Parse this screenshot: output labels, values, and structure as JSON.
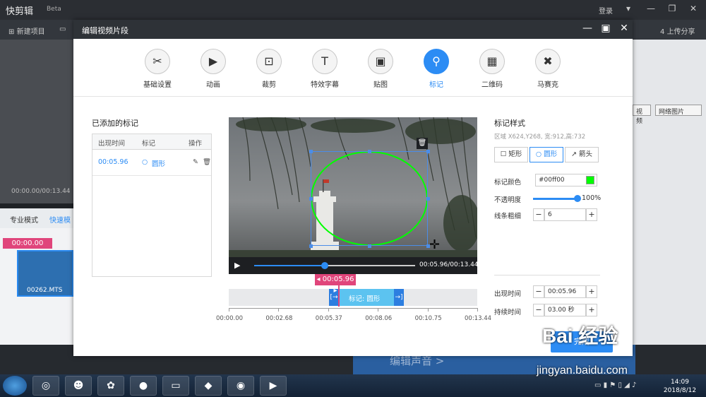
{
  "app": {
    "name": "快剪辑",
    "version": "Beta",
    "login": "登录",
    "new_project": "新建项目",
    "upload_share": "上传分享",
    "upload_step": "4",
    "bg_time": "00:00.00/00:13.44",
    "pro_mode": "专业模式",
    "quick_mode": "快速模",
    "playhead": "00:00.00",
    "clip_name": "00262.MTS",
    "web_image": "网络图片",
    "video_btn": "视频",
    "edit_audio": "编辑声音 >"
  },
  "dialog": {
    "title": "编辑视频片段",
    "tabs": [
      {
        "label": "基础设置",
        "icon": "scissors-icon",
        "glyph": "✂"
      },
      {
        "label": "动画",
        "icon": "animation-icon",
        "glyph": "▶"
      },
      {
        "label": "裁剪",
        "icon": "crop-icon",
        "glyph": "⊡"
      },
      {
        "label": "特效字幕",
        "icon": "text-icon",
        "glyph": "T"
      },
      {
        "label": "贴图",
        "icon": "image-icon",
        "glyph": "▣"
      },
      {
        "label": "标记",
        "icon": "pin-icon",
        "glyph": "⚲"
      },
      {
        "label": "二维码",
        "icon": "qrcode-icon",
        "glyph": "▦"
      },
      {
        "label": "马赛克",
        "icon": "mosaic-icon",
        "glyph": "✖"
      }
    ],
    "active_tab": "标记",
    "marks": {
      "title": "已添加的标记",
      "headers": [
        "出现时间",
        "标记",
        "操作"
      ],
      "rows": [
        {
          "time": "00:05.96",
          "mark": "圆形"
        }
      ]
    },
    "player": {
      "time": "00:05.96/00:13.44",
      "progress": 0.44
    },
    "timeline": {
      "flag": "00:05.96",
      "segment": "标记: 圆形",
      "ticks": [
        "00:00.00",
        "00:02.68",
        "00:05.37",
        "00:08.06",
        "00:10.75",
        "00:13.44"
      ]
    },
    "style": {
      "title": "标记样式",
      "region": "区域 X624,Y268,  宽:912,高:732",
      "shapes": [
        {
          "label": "矩形",
          "glyph": "☐"
        },
        {
          "label": "圆形",
          "glyph": "○"
        },
        {
          "label": "箭头",
          "glyph": "↗"
        }
      ],
      "active_shape": "圆形",
      "color_label": "标记颜色",
      "color_value": "#00ff00",
      "opacity_label": "不透明度",
      "opacity_value": "100%",
      "line_label": "线条粗细",
      "line_value": "6",
      "appear_label": "出现时间",
      "appear_value": "00:05.96",
      "duration_label": "持续时间",
      "duration_value": "03.00 秒",
      "done": "完成"
    }
  },
  "taskbar": {
    "time": "14:09",
    "date": "2018/8/12"
  },
  "watermark": {
    "logo": "Bai 经验",
    "site": "jingyan.baidu.com"
  },
  "colors": {
    "accent": "#2c8cf4",
    "mark_green": "#00ff00",
    "pink": "#e0457b"
  }
}
